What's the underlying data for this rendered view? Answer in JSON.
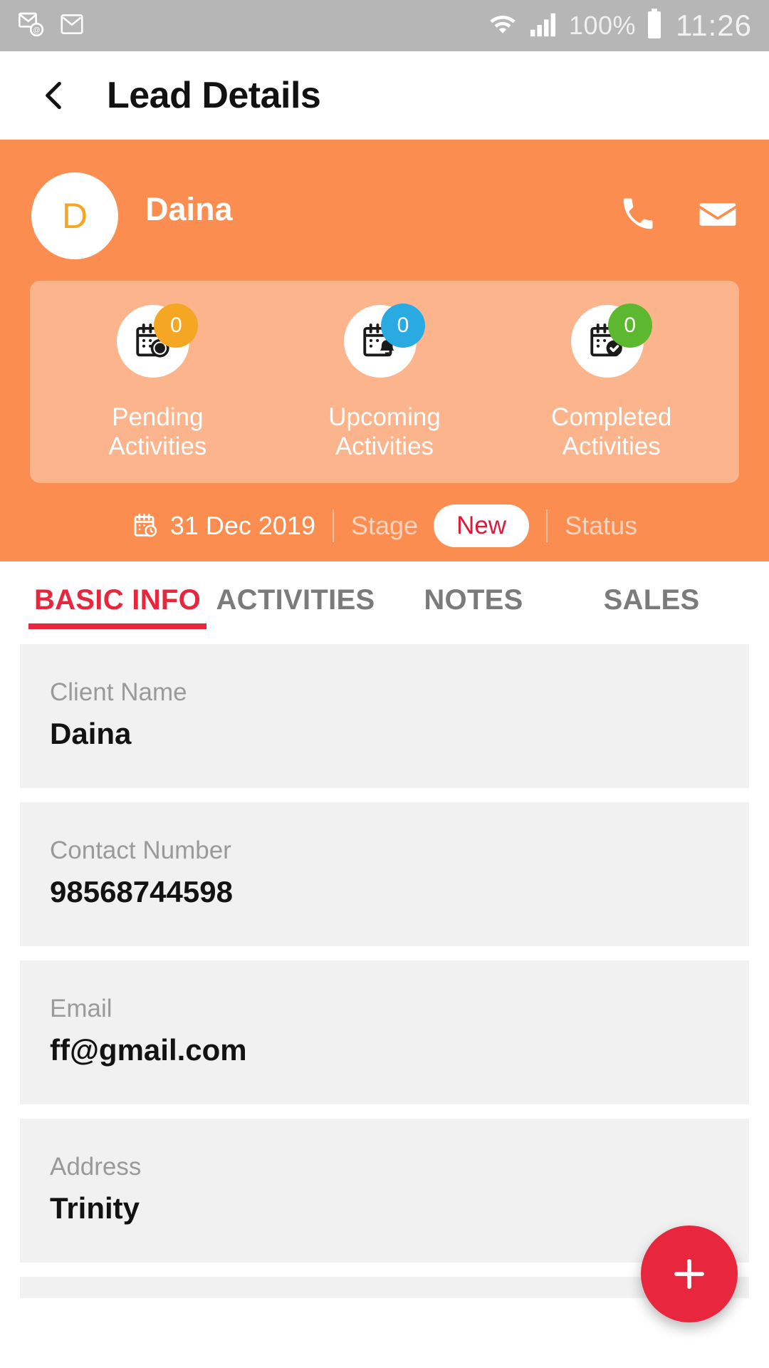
{
  "status_bar": {
    "icons": [
      "email-badge-icon",
      "gmail-icon",
      "wifi-icon",
      "signal-icon"
    ],
    "battery_percent": "100%",
    "time": "11:26"
  },
  "app_bar": {
    "back_label": "back-chevron",
    "title": "Lead Details"
  },
  "hero": {
    "avatar_initial": "D",
    "name": "Daina",
    "actions": [
      {
        "name": "call-button",
        "icon": "phone-icon"
      },
      {
        "name": "email-button",
        "icon": "mail-icon"
      }
    ],
    "activities": [
      {
        "count": "0",
        "label_line1": "Pending",
        "label_line2": "Activities",
        "badge_color": "#F5A623",
        "icon": "calendar-clock-icon"
      },
      {
        "count": "0",
        "label_line1": "Upcoming",
        "label_line2": "Activities",
        "badge_color": "#29ABE2",
        "icon": "calendar-bell-icon"
      },
      {
        "count": "0",
        "label_line1": "Completed",
        "label_line2": "Activities",
        "badge_color": "#5CB82E",
        "icon": "calendar-check-icon"
      }
    ],
    "meta": {
      "date": "31 Dec 2019",
      "stage_label": "Stage",
      "stage_value": "New",
      "status_label": "Status"
    }
  },
  "tabs": [
    {
      "label": "BASIC INFO",
      "active": true
    },
    {
      "label": "ACTIVITIES",
      "active": false
    },
    {
      "label": "NOTES",
      "active": false
    },
    {
      "label": "SALES",
      "active": false
    }
  ],
  "fields": [
    {
      "label": "Client Name",
      "value": "Daina"
    },
    {
      "label": "Contact Number",
      "value": "98568744598"
    },
    {
      "label": "Email",
      "value": "ff@gmail.com"
    },
    {
      "label": "Address",
      "value": "Trinity"
    }
  ],
  "fab": {
    "icon": "plus-icon",
    "label": "+"
  },
  "colors": {
    "hero_orange": "#FB8D51",
    "hero_panel": "#FAAC7D",
    "accent_red": "#E8273F",
    "pill_red": "#E0183C",
    "field_bg": "#F1F1F1",
    "status_bar": "#B6B6B6"
  }
}
